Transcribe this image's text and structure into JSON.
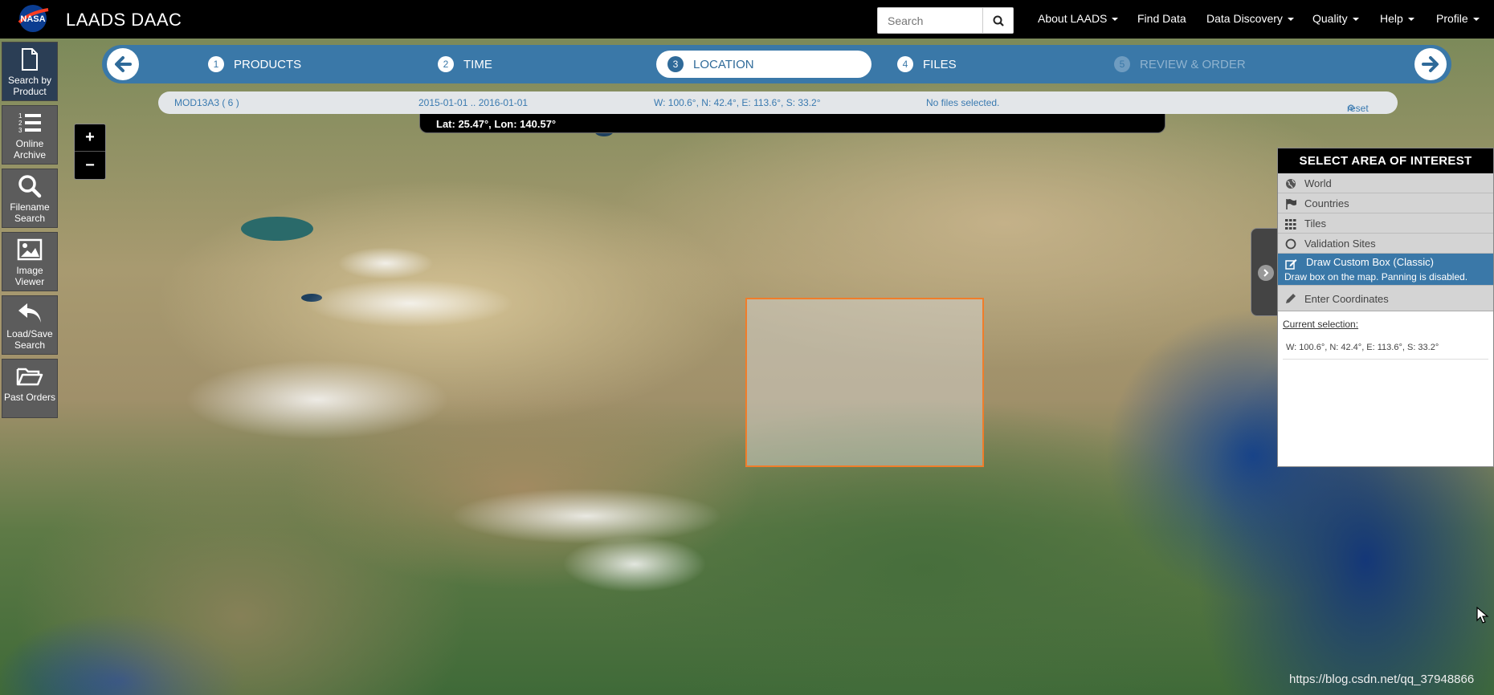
{
  "header": {
    "brand": "LAADS DAAC",
    "logo": "nasa-logo",
    "search_placeholder": "Search",
    "nav": [
      {
        "label": "About LAADS",
        "dropdown": true
      },
      {
        "label": "Find Data",
        "dropdown": false
      },
      {
        "label": "Data Discovery",
        "dropdown": true
      },
      {
        "label": "Quality",
        "dropdown": true
      },
      {
        "label": "Help",
        "dropdown": true
      },
      {
        "label": "Profile",
        "dropdown": true
      }
    ]
  },
  "sidebar": {
    "tools": [
      {
        "label": "Search by Product",
        "icon": "file-icon",
        "active": true
      },
      {
        "label": "Online Archive",
        "icon": "list-icon",
        "active": false
      },
      {
        "label": "Filename Search",
        "icon": "search-icon",
        "active": false
      },
      {
        "label": "Image Viewer",
        "icon": "image-icon",
        "active": false
      },
      {
        "label": "Load/Save Search",
        "icon": "reply-icon",
        "active": false
      },
      {
        "label": "Past Orders",
        "icon": "folder-icon",
        "active": false
      }
    ]
  },
  "wizard": {
    "steps": [
      {
        "num": "1",
        "label": "PRODUCTS",
        "state": "done"
      },
      {
        "num": "2",
        "label": "TIME",
        "state": "done"
      },
      {
        "num": "3",
        "label": "LOCATION",
        "state": "active"
      },
      {
        "num": "4",
        "label": "FILES",
        "state": "pending"
      },
      {
        "num": "5",
        "label": "REVIEW & ORDER",
        "state": "disabled"
      }
    ]
  },
  "summary": {
    "product": "MOD13A3 ( 6 )",
    "dates": "2015-01-01 .. 2016-01-01",
    "bbox": "W: 100.6°, N: 42.4°, E: 113.6°, S: 33.2°",
    "files": "No files selected.",
    "reset": "reset"
  },
  "map": {
    "cursor_coords": "Lat: 25.47°, Lon: 140.57°",
    "zoom_in": "+",
    "zoom_out": "−"
  },
  "aoi_panel": {
    "title": "SELECT AREA OF INTEREST",
    "options": [
      {
        "label": "World",
        "icon": "globe-icon"
      },
      {
        "label": "Countries",
        "icon": "flag-icon"
      },
      {
        "label": "Tiles",
        "icon": "grid-icon"
      },
      {
        "label": "Validation Sites",
        "icon": "circle-icon"
      },
      {
        "label": "Draw Custom Box (Classic)",
        "icon": "edit-icon",
        "active": true,
        "hint": "Draw box on the map. Panning is disabled."
      },
      {
        "label": "Enter Coordinates",
        "icon": "pencil-icon"
      }
    ],
    "current_label": "Current selection:",
    "current_value": "W: 100.6°, N: 42.4°, E: 113.6°, S: 33.2°"
  },
  "watermark": "https://blog.csdn.net/qq_37948866",
  "colors": {
    "accent": "#3a78a8",
    "selection_border": "#f07d2a",
    "sidebar_active": "#2b3e55"
  }
}
